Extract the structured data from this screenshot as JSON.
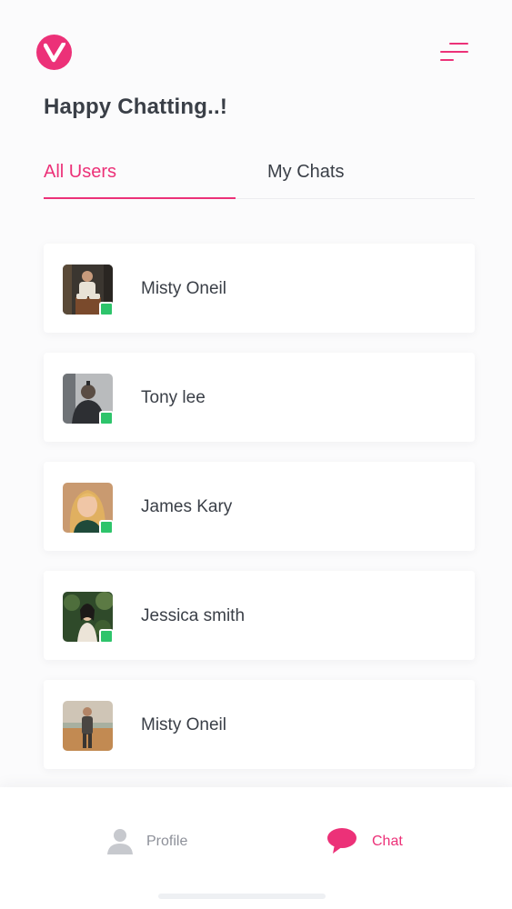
{
  "header": {
    "title": "Happy Chatting..!",
    "logo_icon": "checkmark-icon",
    "menu_icon": "hamburger-menu-icon"
  },
  "tabs": [
    {
      "label": "All Users",
      "active": true
    },
    {
      "label": "My Chats",
      "active": false
    }
  ],
  "users": [
    {
      "name": "Misty Oneil",
      "online": true
    },
    {
      "name": "Tony lee",
      "online": true
    },
    {
      "name": "James Kary",
      "online": true
    },
    {
      "name": "Jessica smith",
      "online": true
    },
    {
      "name": "Misty Oneil",
      "online": false
    }
  ],
  "bottom_nav": [
    {
      "label": "Profile",
      "icon": "person-icon",
      "active": false
    },
    {
      "label": "Chat",
      "icon": "chat-bubble-icon",
      "active": true
    }
  ],
  "colors": {
    "accent": "#ec3178",
    "online": "#2ec46b",
    "text": "#3a3f47",
    "muted": "#8d9099"
  }
}
